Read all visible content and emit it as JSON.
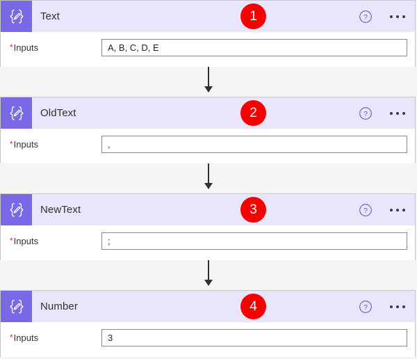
{
  "window": {
    "background_color": "#f5f5f5"
  },
  "theme": {
    "icon_tile_color": "#7a69e6",
    "header_background": "#e9e5fb",
    "badge_color": "#f60000",
    "badge_text_color": "#ffffff",
    "required_marker_color": "#d13438",
    "help_icon_color": "#5b5fc7",
    "card_border_color": "#c8c6c4",
    "input_border_color": "#8a8886",
    "connector_color": "#323130"
  },
  "field_label": "Inputs",
  "required_marker": "*",
  "icons": {
    "card": "expression-pencil-icon",
    "help": "help-circle-icon",
    "more": "more-horizontal-icon"
  },
  "cards": [
    {
      "title": "Text",
      "badge": "1",
      "input_label": "Inputs",
      "input_value": "A, B, C, D, E",
      "input_placeholder": ""
    },
    {
      "title": "OldText",
      "badge": "2",
      "input_label": "Inputs",
      "input_value": ",",
      "input_placeholder": ""
    },
    {
      "title": "NewText",
      "badge": "3",
      "input_label": "Inputs",
      "input_value": ";",
      "input_placeholder": ""
    },
    {
      "title": "Number",
      "badge": "4",
      "input_label": "Inputs",
      "input_value": "3",
      "input_placeholder": ""
    }
  ]
}
